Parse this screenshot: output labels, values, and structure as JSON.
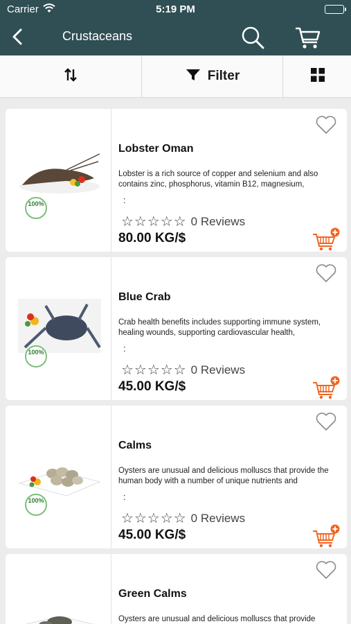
{
  "status_bar": {
    "carrier": "Carrier",
    "time": "5:19 PM"
  },
  "nav": {
    "title": "Crustaceans",
    "icons": [
      "back-chevron-icon",
      "search-icon",
      "cart-icon"
    ]
  },
  "toolbar": {
    "filter_label": "Filter",
    "icons": [
      "sort-icon",
      "filter-funnel-icon",
      "grid-view-icon"
    ]
  },
  "colors": {
    "header": "#2f4f54",
    "accent": "#f26522",
    "badge_green": "#7cbf7a"
  },
  "products": [
    {
      "name": "Lobster Oman",
      "description": "Lobster is a rich source of copper and selenium and also contains zinc, phosphorus, vitamin B12, magnesium,",
      "colon": ":",
      "stars": "☆☆☆☆☆",
      "reviews": "0 Reviews",
      "price": "80.00 KG/$",
      "badge": "100%"
    },
    {
      "name": "Blue Crab",
      "description": "Crab health benefits includes supporting immune system, healing wounds, supporting cardiovascular health,",
      "colon": ":",
      "stars": "☆☆☆☆☆",
      "reviews": "0 Reviews",
      "price": "45.00 KG/$",
      "badge": "100%"
    },
    {
      "name": "Calms",
      "description": "Oysters are unusual and delicious molluscs that provide the human body with a number of unique nutrients and",
      "colon": ":",
      "stars": "☆☆☆☆☆",
      "reviews": "0 Reviews",
      "price": "45.00 KG/$",
      "badge": "100%"
    },
    {
      "name": "Green Calms",
      "description": "Oysters are unusual and delicious molluscs that provide",
      "colon": "",
      "stars": "",
      "reviews": "",
      "price": "",
      "badge": ""
    }
  ]
}
